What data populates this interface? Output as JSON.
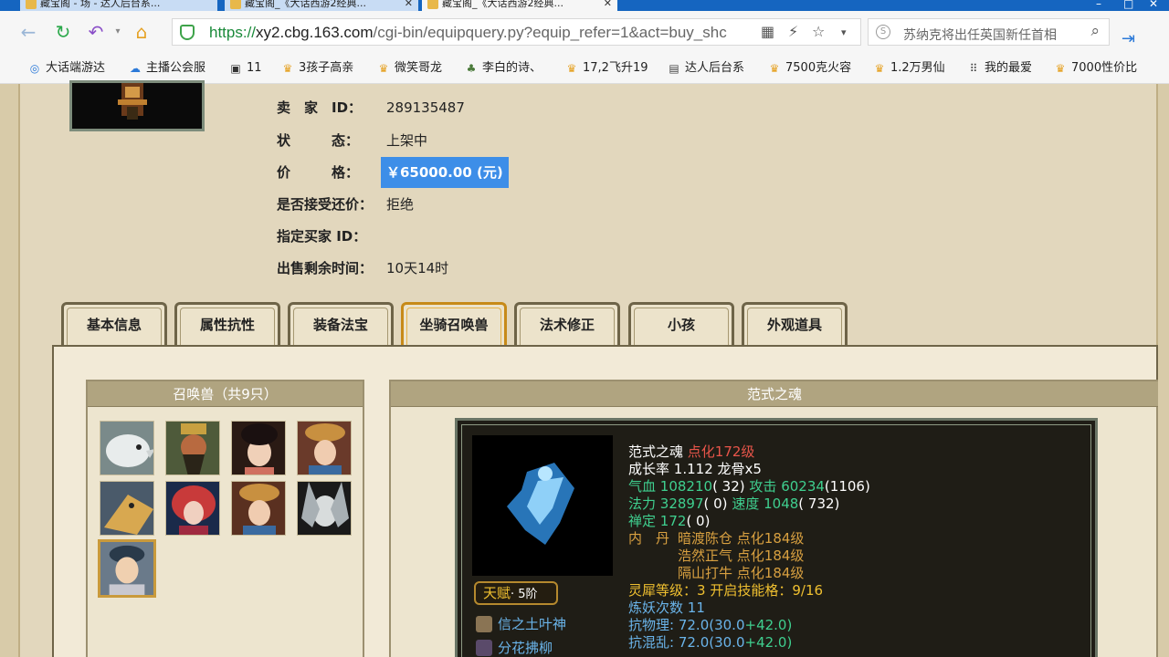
{
  "browser": {
    "tabs": [
      {
        "label": "藏宝阁 - 场 - 达人后台系..."
      },
      {
        "label": "藏宝阁_《大话西游2经典..."
      },
      {
        "label": "藏宝阁_《大话西游2经典..."
      }
    ],
    "url": {
      "scheme": "https://",
      "host": "xy2.cbg.163.com",
      "path": "/cgi-bin/equipquery.py?equip_refer=1&act=buy_shc"
    },
    "search_text": "苏纳克将出任英国新任首相",
    "bookmarks": [
      {
        "label": "大话端游达",
        "icon": "swirl-icon"
      },
      {
        "label": "主播公会服",
        "icon": "cloud-icon"
      },
      {
        "label": "11",
        "icon": "square-icon"
      },
      {
        "label": "3孩子高亲",
        "icon": "crown-icon"
      },
      {
        "label": "微笑哥龙",
        "icon": "crown-icon"
      },
      {
        "label": "李白的诗、",
        "icon": "tree-icon"
      },
      {
        "label": "17,2飞升19",
        "icon": "crown-icon"
      },
      {
        "label": "达人后台系",
        "icon": "doc-icon"
      },
      {
        "label": "7500克火容",
        "icon": "crown-icon"
      },
      {
        "label": "1.2万男仙",
        "icon": "crown-icon"
      },
      {
        "label": "我的最爱",
        "icon": "grid-icon"
      },
      {
        "label": "7000性价比",
        "icon": "crown-icon"
      }
    ]
  },
  "seller": {
    "id_label": "卖　家　ID：",
    "id_value": "289135487",
    "status_label": "状　　　态：",
    "status_value": "上架中",
    "price_label": "价　　　格：",
    "price_value": "￥65000.00 (元)",
    "bargain_label": "是否接受还价：",
    "bargain_value": "拒绝",
    "buyer_label": "指定买家 ID：",
    "buyer_value": "",
    "time_label": "出售剩余时间：",
    "time_value": "10天14时"
  },
  "tabs": [
    "基本信息",
    "属性抗性",
    "装备法宝",
    "坐骑召唤兽",
    "法术修正",
    "小孩",
    "外观道具"
  ],
  "active_tab": "坐骑召唤兽",
  "pets": {
    "header": "召唤兽（共9只）",
    "items": [
      {
        "name": "white-wolf-pet"
      },
      {
        "name": "guan-yu-pet"
      },
      {
        "name": "girl-pet"
      },
      {
        "name": "dancer-pet"
      },
      {
        "name": "golden-bird-pet"
      },
      {
        "name": "red-hair-pet"
      },
      {
        "name": "dancer2-pet"
      },
      {
        "name": "pale-face-pet"
      },
      {
        "name": "young-warrior-pet"
      }
    ]
  },
  "detail": {
    "header": "范式之魂",
    "talent_label": "天赋",
    "talent_level": "· 5阶",
    "skills": [
      "信之土叶神",
      "分花拂柳"
    ],
    "name": "范式之魂",
    "name_level": "点化172级",
    "growth_label": "成长率",
    "growth_value": "1.112",
    "growth_extra": "龙骨x5",
    "hp_label": "气血",
    "hp_value": "108210",
    "hp_extra": "( 32)",
    "atk_label": "攻击",
    "atk_value": "60234",
    "atk_extra": "(1106)",
    "mp_label": "法力",
    "mp_value": "32897",
    "mp_extra": "( 0)",
    "spd_label": "速度",
    "spd_value": "1048",
    "spd_extra": "( 732)",
    "zen_label": "禅定",
    "zen_value": "172",
    "zen_extra": "( 0)",
    "neidan_label": "内　丹",
    "neidan": [
      {
        "name": "暗渡陈仓",
        "level": "点化184级"
      },
      {
        "name": "浩然正气",
        "level": "点化184级"
      },
      {
        "name": "隔山打牛",
        "level": "点化184级"
      }
    ],
    "soul_label": "灵犀等级：",
    "soul_value": "3",
    "slots_label": "开启技能格：",
    "slots_value": "9/16",
    "refine_label": "炼妖次数",
    "refine_value": "11",
    "res1_label": "抗物理:",
    "res1_value": "72.0(30.0",
    "res1_plus": "+42.0)",
    "res2_label": "抗混乱:",
    "res2_value": "72.0(30.0",
    "res2_plus": "+42.0)"
  },
  "colors": {
    "accent": "#3d8ee8",
    "page_bg": "#e2d7bd",
    "panel_header": "#b0a480",
    "active_tab_border": "#c78a18"
  }
}
